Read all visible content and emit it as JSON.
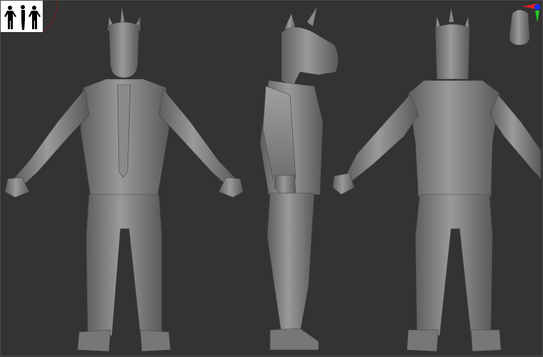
{
  "viewport": {
    "background": "#333333",
    "model_color": "#8c8c8c",
    "views": [
      "front",
      "side",
      "back"
    ]
  },
  "gizmo": {
    "x_axis_color": "#e02020",
    "y_axis_color": "#20d020",
    "z_axis_color": "#1030ff"
  }
}
